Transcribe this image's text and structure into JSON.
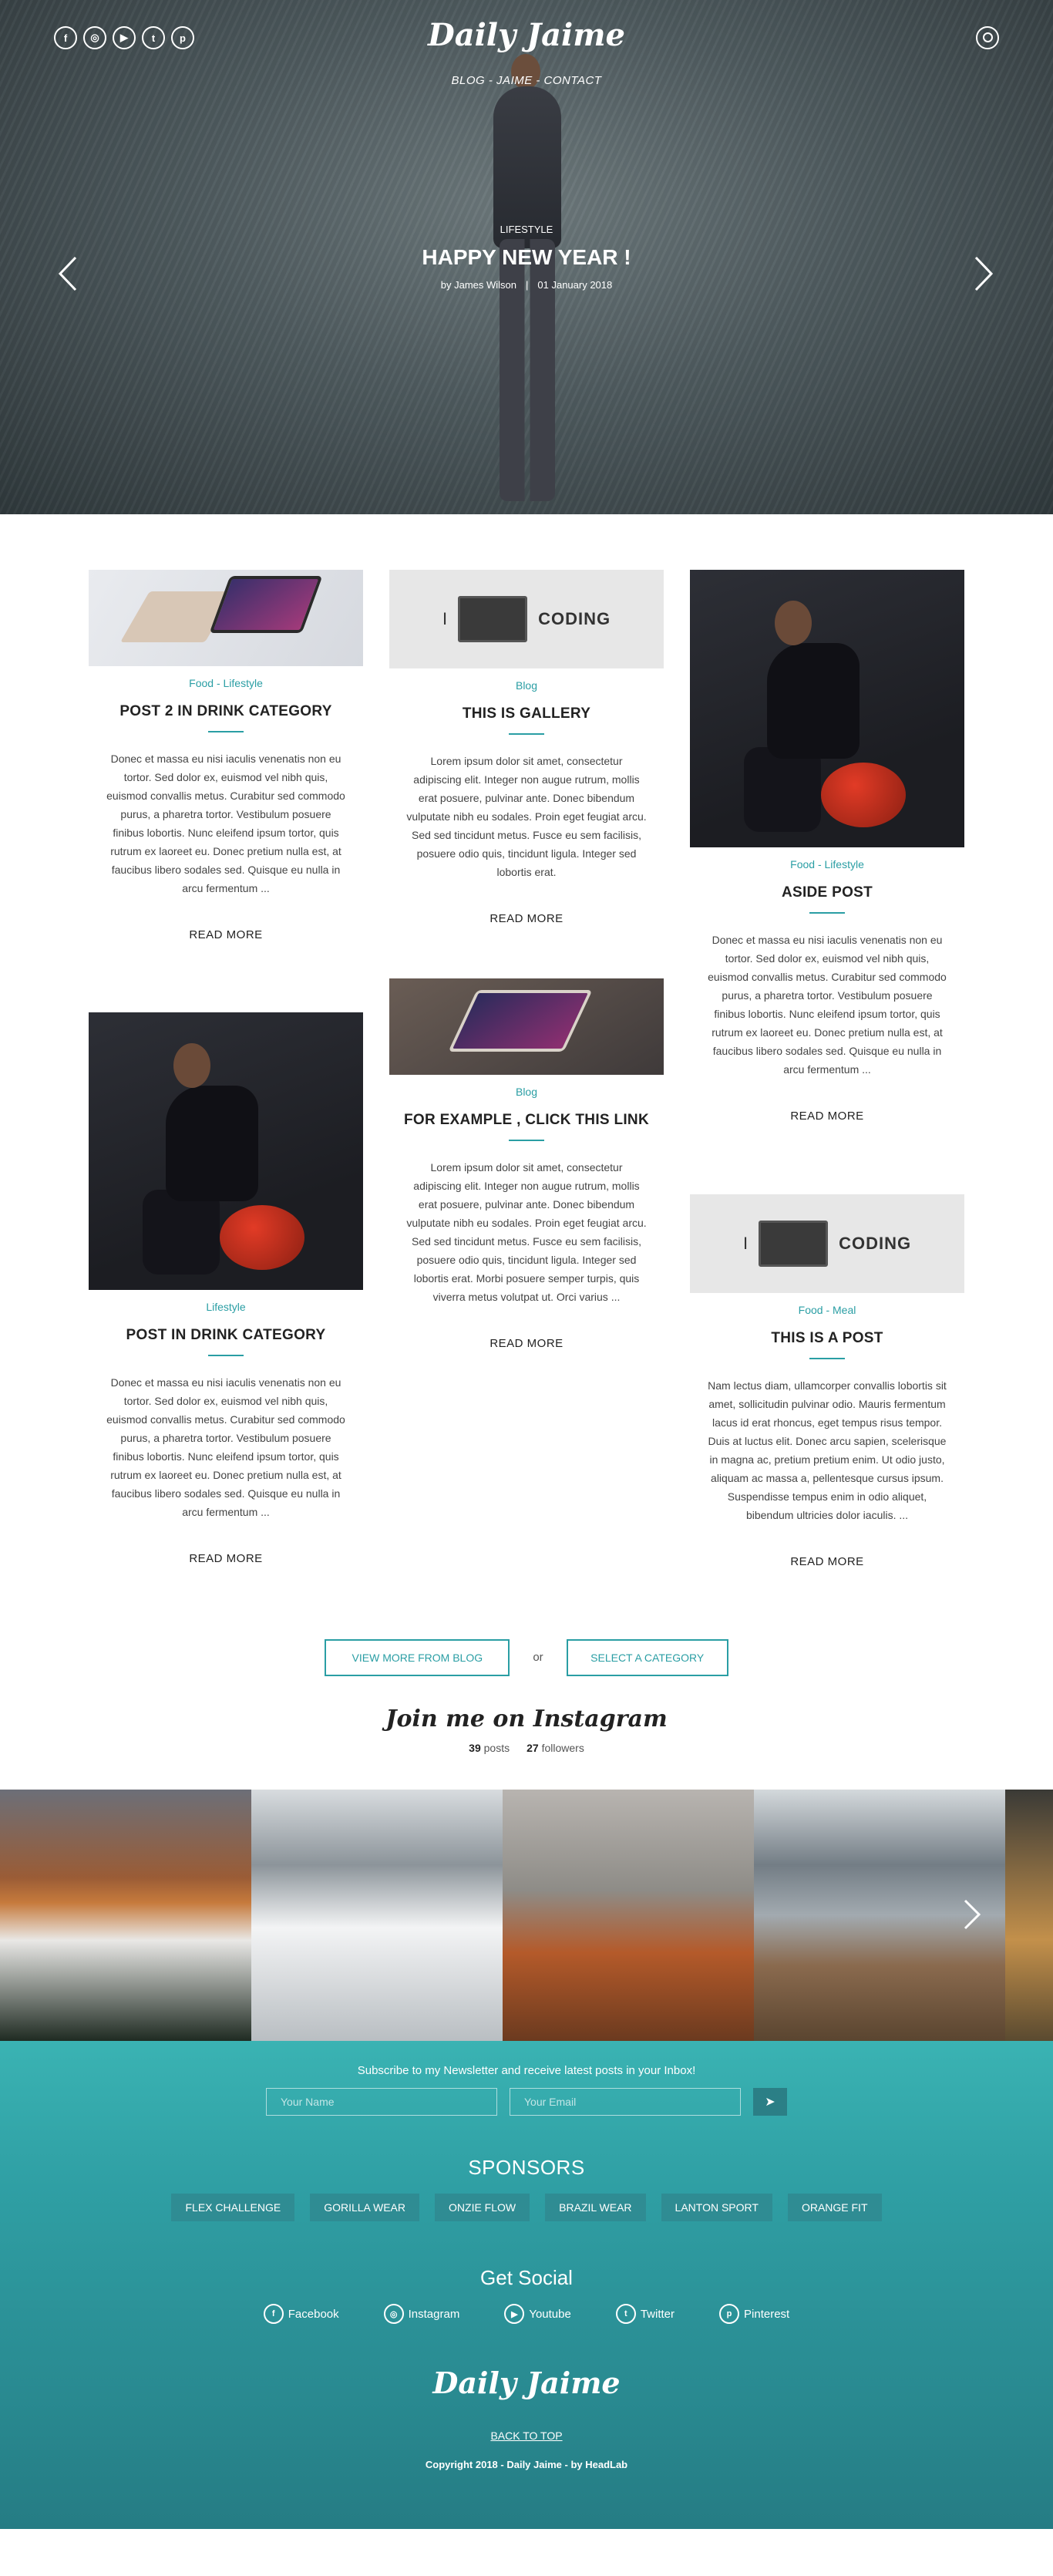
{
  "header": {
    "logo": "Daily Jaime",
    "nav": "BLOG  -  JAIME  -  CONTACT",
    "social_icons": [
      "facebook-icon",
      "instagram-icon",
      "youtube-icon",
      "twitter-icon",
      "pinterest-icon"
    ],
    "social_glyphs": [
      "f",
      "◎",
      "▶",
      "t",
      "p"
    ]
  },
  "hero": {
    "category": "LIFESTYLE",
    "title": "HAPPY NEW YEAR !",
    "author": "by James Wilson",
    "date": "01 January 2018"
  },
  "posts": [
    {
      "category": "Food - Lifestyle",
      "title": "POST 2 IN DRINK CATEGORY",
      "excerpt": "Donec et massa eu nisi iaculis venenatis non eu tortor. Sed dolor ex, euismod vel nibh quis, euismod convallis metus. Curabitur sed commodo purus, a pharetra tortor. Vestibulum posuere finibus lobortis. Nunc eleifend ipsum tortor, quis rutrum ex laoreet eu. Donec pretium nulla est, at faucibus libero sodales sed. Quisque eu nulla in arcu fermentum ...",
      "more": "READ MORE"
    },
    {
      "category": "Blog",
      "title": "THIS IS GALLERY",
      "excerpt": "Lorem ipsum dolor sit amet, consectetur adipiscing elit. Integer non augue rutrum, mollis erat posuere, pulvinar ante. Donec bibendum vulputate nibh eu sodales. Proin eget feugiat arcu. Sed sed tincidunt metus. Fusce eu sem facilisis, posuere odio quis, tincidunt ligula. Integer sed lobortis erat.",
      "more": "READ MORE"
    },
    {
      "category": "Food - Lifestyle",
      "title": "ASIDE POST",
      "excerpt": "Donec et massa eu nisi iaculis venenatis non eu tortor. Sed dolor ex, euismod vel nibh quis, euismod convallis metus. Curabitur sed commodo purus, a pharetra tortor. Vestibulum posuere finibus lobortis. Nunc eleifend ipsum tortor, quis rutrum ex laoreet eu. Donec pretium nulla est, at faucibus libero sodales sed. Quisque eu nulla in arcu fermentum ...",
      "more": "READ MORE"
    },
    {
      "category": "Lifestyle",
      "title": "POST IN DRINK CATEGORY",
      "excerpt": "Donec et massa eu nisi iaculis venenatis non eu tortor. Sed dolor ex, euismod vel nibh quis, euismod convallis metus. Curabitur sed commodo purus, a pharetra tortor. Vestibulum posuere finibus lobortis. Nunc eleifend ipsum tortor, quis rutrum ex laoreet eu. Donec pretium nulla est, at faucibus libero sodales sed. Quisque eu nulla in arcu fermentum ...",
      "more": "READ MORE"
    },
    {
      "category": "Blog",
      "title": "FOR EXAMPLE , CLICK THIS LINK",
      "excerpt": "Lorem ipsum dolor sit amet, consectetur adipiscing elit. Integer non augue rutrum, mollis erat posuere, pulvinar ante. Donec bibendum vulputate nibh eu sodales. Proin eget feugiat arcu. Sed sed tincidunt metus. Fusce eu sem facilisis, posuere odio quis, tincidunt ligula. Integer sed lobortis erat. Morbi posuere semper turpis, quis viverra metus volutpat ut. Orci varius ...",
      "more": "READ MORE"
    },
    {
      "category": "Food - Meal",
      "title": "THIS IS A POST",
      "excerpt": "Nam lectus diam, ullamcorper convallis lobortis sit amet, sollicitudin pulvinar odio. Mauris fermentum lacus id erat rhoncus, eget tempus risus tempor. Duis at luctus elit. Donec arcu sapien, scelerisque in magna ac, pretium pretium enim. Ut odio justo, aliquam ac massa a, pellentesque cursus ipsum. Suspendisse tempus enim in odio aliquet, bibendum ultricies dolor iaculis. ...",
      "more": "READ MORE"
    }
  ],
  "coding_thumb": {
    "left": "I",
    "word": "CODING"
  },
  "actions": {
    "view_more": "VIEW MORE FROM BLOG",
    "or": "or",
    "select_category": "SELECT A CATEGORY"
  },
  "instagram": {
    "title": "Join me on Instagram",
    "posts_count": "39",
    "posts_label": "posts",
    "followers_count": "27",
    "followers_label": "followers"
  },
  "newsletter": {
    "text": "Subscribe to my Newsletter and receive latest posts in your Inbox!",
    "name_placeholder": "Your Name",
    "email_placeholder": "Your Email",
    "send_icon": "send-icon"
  },
  "sponsors": {
    "title": "SPONSORS",
    "items": [
      "FLEX CHALLENGE",
      "GORILLA WEAR",
      "ONZIE FLOW",
      "BRAZIL WEAR",
      "LANTON SPORT",
      "ORANGE FIT"
    ]
  },
  "social": {
    "title": "Get Social",
    "items": [
      "Facebook",
      "Instagram",
      "Youtube",
      "Twitter",
      "Pinterest"
    ]
  },
  "footer": {
    "logo": "Daily Jaime",
    "back_to_top": "BACK TO TOP",
    "copyright": "Copyright 2018 - Daily Jaime - by HeadLab"
  },
  "colors": {
    "accent": "#2a9ea4",
    "footer_top": "#3ab3b3",
    "footer_bottom": "#257c84"
  }
}
